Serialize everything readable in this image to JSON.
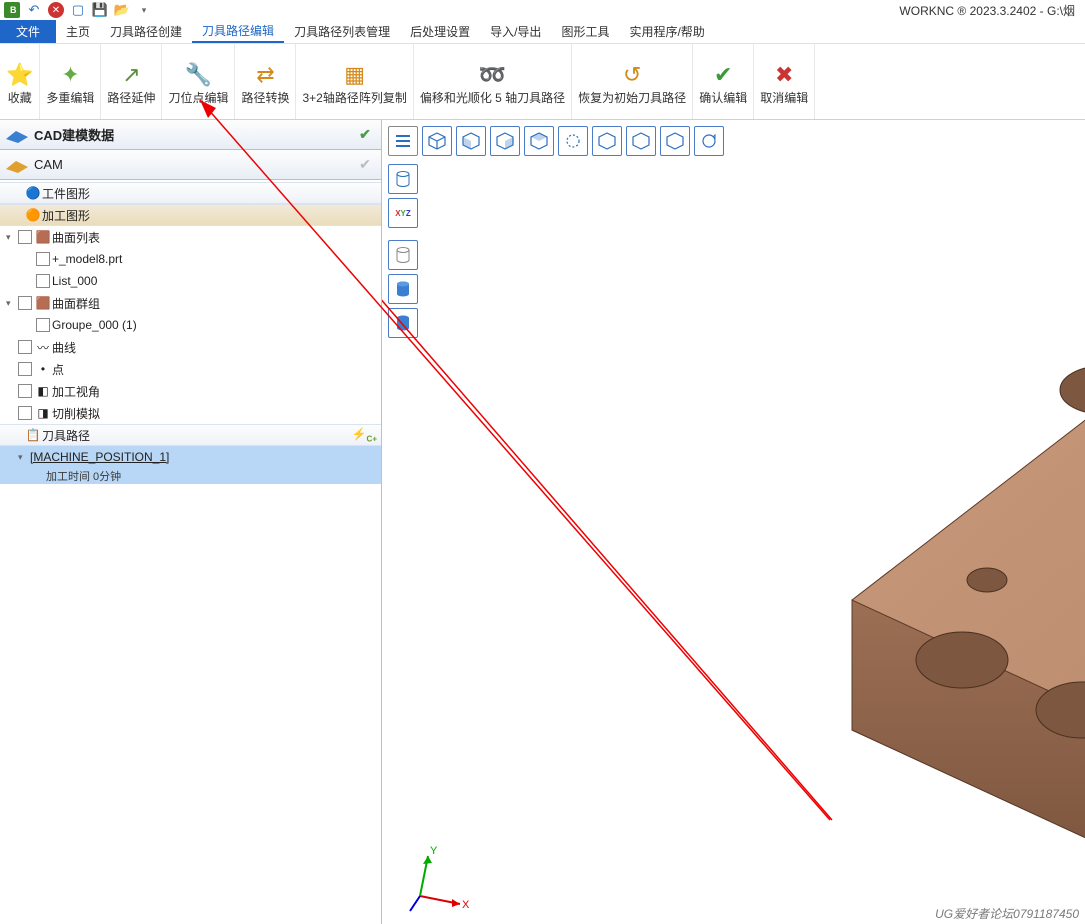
{
  "title": "WORKNC ® 2023.3.2402 - G:\\烟",
  "qat": {
    "items": [
      "logo",
      "undo",
      "close",
      "new",
      "save",
      "open",
      "dropdown"
    ]
  },
  "menu": {
    "file": "文件",
    "tabs": [
      "主页",
      "刀具路径创建",
      "刀具路径编辑",
      "刀具路径列表管理",
      "后处理设置",
      "导入/导出",
      "图形工具",
      "实用程序/帮助"
    ],
    "active": 2
  },
  "ribbon": [
    {
      "icon": "star",
      "label": "收藏"
    },
    {
      "icon": "multi",
      "label": "多重编辑"
    },
    {
      "icon": "extend",
      "label": "路径延伸"
    },
    {
      "icon": "ptedit",
      "label": "刀位点编辑"
    },
    {
      "icon": "conv",
      "label": "路径转换"
    },
    {
      "icon": "arr",
      "label": "3+2轴路径阵列复制"
    },
    {
      "icon": "smooth",
      "label": "偏移和光顺化 5 轴刀具路径"
    },
    {
      "icon": "restore",
      "label": "恢复为初始刀具路径"
    },
    {
      "icon": "confirm",
      "label": "确认编辑"
    },
    {
      "icon": "cancel",
      "label": "取消编辑"
    }
  ],
  "panels": {
    "cad": "CAD建模数据",
    "cam": "CAM"
  },
  "tree": {
    "s1": "工件图形",
    "s2": "加工图形",
    "surfList": "曲面列表",
    "surfItems": [
      "+_model8.prt",
      "List_000"
    ],
    "surfGroup": "曲面群组",
    "groupItems": [
      "Groupe_000 (1)"
    ],
    "curve": "曲线",
    "point": "点",
    "viewangle": "加工视角",
    "cutsim": "切削模拟",
    "toolpath": "刀具路径",
    "mp": "[MACHINE_POSITION_1]",
    "mptime": "加工时间 0分钟"
  },
  "axes": {
    "x": "X",
    "y": "Y",
    "z": "Z"
  },
  "watermark": "UG爱好者论坛0791187450"
}
